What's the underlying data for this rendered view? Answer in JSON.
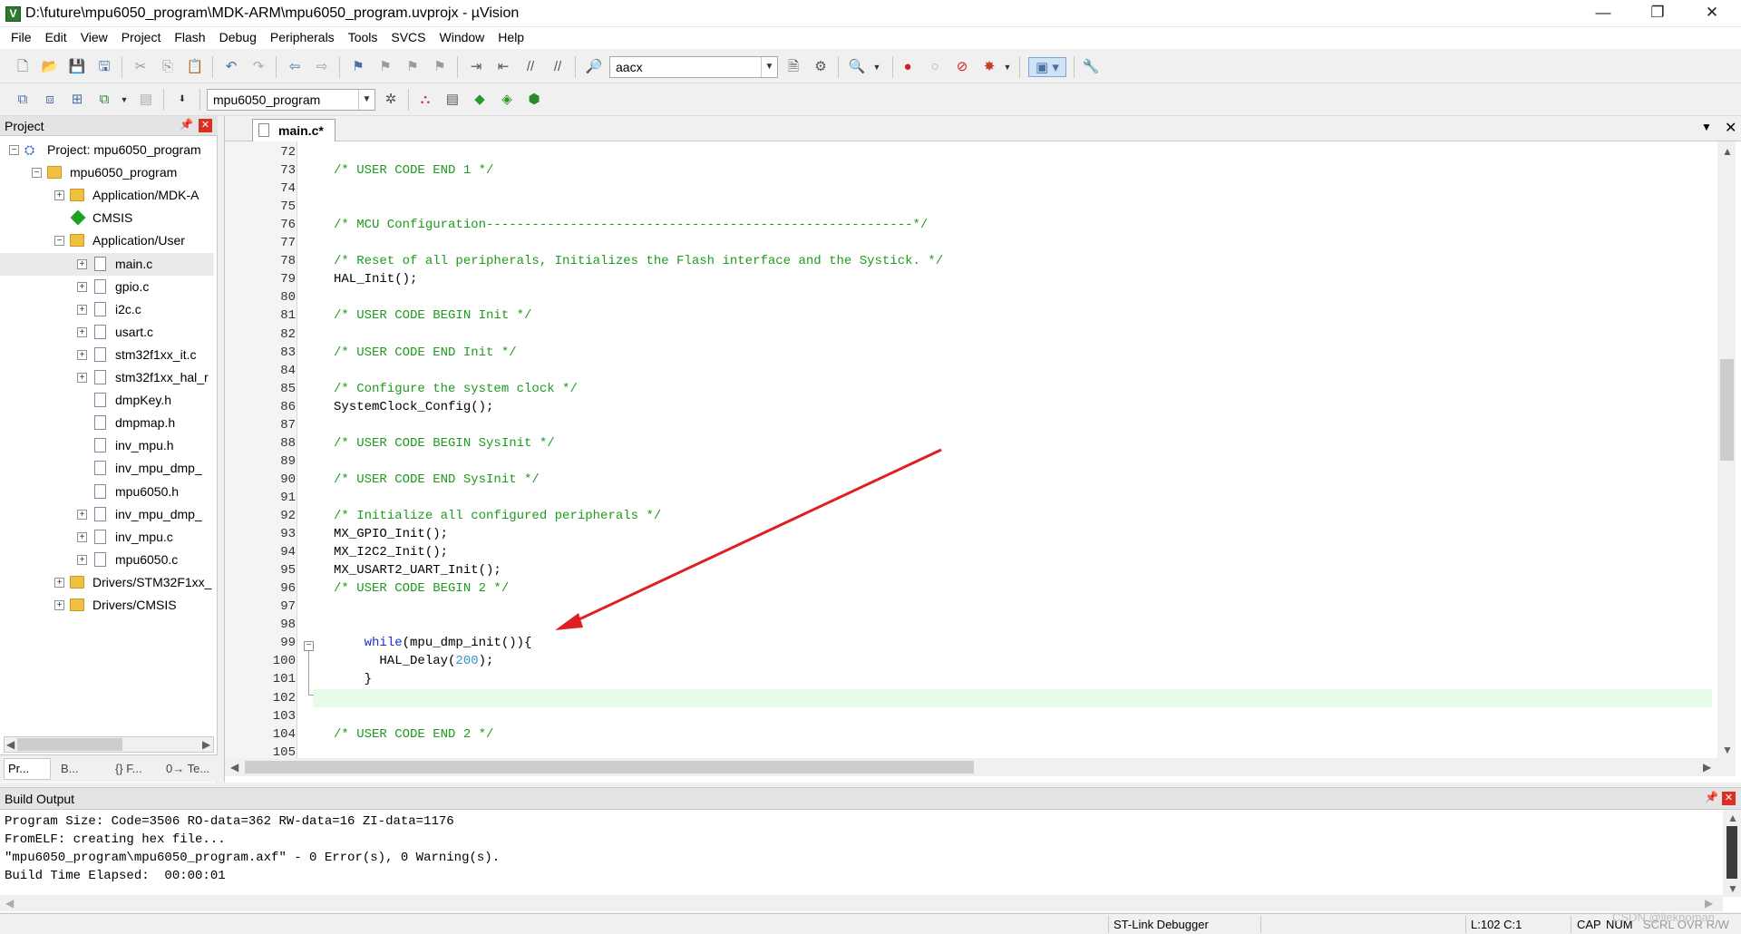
{
  "window": {
    "title": "D:\\future\\mpu6050_program\\MDK-ARM\\mpu6050_program.uvprojx - µVision",
    "app_icon_letter": "V",
    "buttons": {
      "minimize": "—",
      "restore": "❐",
      "close": "✕"
    }
  },
  "menu": [
    "File",
    "Edit",
    "View",
    "Project",
    "Flash",
    "Debug",
    "Peripherals",
    "Tools",
    "SVCS",
    "Window",
    "Help"
  ],
  "toolbar1": {
    "find_combo_value": "aacx"
  },
  "toolbar2": {
    "target_combo_value": "mpu6050_program"
  },
  "project_panel": {
    "title": "Project",
    "tree": [
      {
        "label": "Project: mpu6050_program",
        "level": 0,
        "toggle": "−",
        "icon": "project"
      },
      {
        "label": "mpu6050_program",
        "level": 1,
        "toggle": "−",
        "icon": "folder"
      },
      {
        "label": "Application/MDK-A",
        "level": 2,
        "toggle": "+",
        "icon": "folder"
      },
      {
        "label": "CMSIS",
        "level": 2,
        "toggle": "",
        "icon": "diamond"
      },
      {
        "label": "Application/User",
        "level": 2,
        "toggle": "−",
        "icon": "folder"
      },
      {
        "label": "main.c",
        "level": 3,
        "toggle": "+",
        "icon": "file",
        "selected": true
      },
      {
        "label": "gpio.c",
        "level": 3,
        "toggle": "+",
        "icon": "file"
      },
      {
        "label": "i2c.c",
        "level": 3,
        "toggle": "+",
        "icon": "file"
      },
      {
        "label": "usart.c",
        "level": 3,
        "toggle": "+",
        "icon": "file"
      },
      {
        "label": "stm32f1xx_it.c",
        "level": 3,
        "toggle": "+",
        "icon": "file"
      },
      {
        "label": "stm32f1xx_hal_r",
        "level": 3,
        "toggle": "+",
        "icon": "file"
      },
      {
        "label": "dmpKey.h",
        "level": 3,
        "toggle": "",
        "icon": "file"
      },
      {
        "label": "dmpmap.h",
        "level": 3,
        "toggle": "",
        "icon": "file"
      },
      {
        "label": "inv_mpu.h",
        "level": 3,
        "toggle": "",
        "icon": "file"
      },
      {
        "label": "inv_mpu_dmp_",
        "level": 3,
        "toggle": "",
        "icon": "file"
      },
      {
        "label": "mpu6050.h",
        "level": 3,
        "toggle": "",
        "icon": "file"
      },
      {
        "label": "inv_mpu_dmp_",
        "level": 3,
        "toggle": "+",
        "icon": "file"
      },
      {
        "label": "inv_mpu.c",
        "level": 3,
        "toggle": "+",
        "icon": "file"
      },
      {
        "label": "mpu6050.c",
        "level": 3,
        "toggle": "+",
        "icon": "file"
      },
      {
        "label": "Drivers/STM32F1xx_",
        "level": 2,
        "toggle": "+",
        "icon": "folder"
      },
      {
        "label": "Drivers/CMSIS",
        "level": 2,
        "toggle": "+",
        "icon": "folder"
      }
    ],
    "tabs": [
      "Pr...",
      "B...",
      "{} F...",
      "0→ Te..."
    ]
  },
  "editor": {
    "active_tab": "main.c*",
    "current_line": 102,
    "lines": [
      {
        "n": "72",
        "segs": []
      },
      {
        "n": "73",
        "segs": [
          {
            "t": "/* USER CODE END 1 */",
            "c": "cm"
          }
        ]
      },
      {
        "n": "74",
        "segs": []
      },
      {
        "n": "75",
        "segs": []
      },
      {
        "n": "76",
        "segs": [
          {
            "t": "/* MCU Configuration--------------------------------------------------------*/",
            "c": "cm"
          }
        ]
      },
      {
        "n": "77",
        "segs": []
      },
      {
        "n": "78",
        "segs": [
          {
            "t": "/* Reset of all peripherals, Initializes the Flash interface and the Systick. */",
            "c": "cm"
          }
        ]
      },
      {
        "n": "79",
        "segs": [
          {
            "t": "HAL_Init();",
            "c": ""
          }
        ]
      },
      {
        "n": "80",
        "segs": []
      },
      {
        "n": "81",
        "segs": [
          {
            "t": "/* USER CODE BEGIN Init */",
            "c": "cm"
          }
        ]
      },
      {
        "n": "82",
        "segs": []
      },
      {
        "n": "83",
        "segs": [
          {
            "t": "/* USER CODE END Init */",
            "c": "cm"
          }
        ]
      },
      {
        "n": "84",
        "segs": []
      },
      {
        "n": "85",
        "segs": [
          {
            "t": "/* Configure the system clock */",
            "c": "cm"
          }
        ]
      },
      {
        "n": "86",
        "segs": [
          {
            "t": "SystemClock_Config();",
            "c": ""
          }
        ]
      },
      {
        "n": "87",
        "segs": []
      },
      {
        "n": "88",
        "segs": [
          {
            "t": "/* USER CODE BEGIN SysInit */",
            "c": "cm"
          }
        ]
      },
      {
        "n": "89",
        "segs": []
      },
      {
        "n": "90",
        "segs": [
          {
            "t": "/* USER CODE END SysInit */",
            "c": "cm"
          }
        ]
      },
      {
        "n": "91",
        "segs": []
      },
      {
        "n": "92",
        "segs": [
          {
            "t": "/* Initialize all configured peripherals */",
            "c": "cm"
          }
        ]
      },
      {
        "n": "93",
        "segs": [
          {
            "t": "MX_GPIO_Init();",
            "c": ""
          }
        ]
      },
      {
        "n": "94",
        "segs": [
          {
            "t": "MX_I2C2_Init();",
            "c": ""
          }
        ]
      },
      {
        "n": "95",
        "segs": [
          {
            "t": "MX_USART2_UART_Init();",
            "c": ""
          }
        ]
      },
      {
        "n": "96",
        "segs": [
          {
            "t": "/* USER CODE BEGIN 2 */",
            "c": "cm"
          }
        ]
      },
      {
        "n": "97",
        "segs": []
      },
      {
        "n": "98",
        "segs": []
      },
      {
        "n": "99",
        "segs": [
          {
            "t": "    ",
            "c": ""
          },
          {
            "t": "while",
            "c": "kw"
          },
          {
            "t": "(mpu_dmp_init()){",
            "c": ""
          }
        ]
      },
      {
        "n": "100",
        "segs": [
          {
            "t": "      HAL_Delay(",
            "c": ""
          },
          {
            "t": "200",
            "c": "num"
          },
          {
            "t": ");",
            "c": ""
          }
        ]
      },
      {
        "n": "101",
        "segs": [
          {
            "t": "    }",
            "c": ""
          }
        ]
      },
      {
        "n": "102",
        "segs": []
      },
      {
        "n": "103",
        "segs": []
      },
      {
        "n": "104",
        "segs": [
          {
            "t": "/* USER CODE END 2 */",
            "c": "cm"
          }
        ]
      },
      {
        "n": "105",
        "segs": []
      }
    ]
  },
  "build_output": {
    "title": "Build Output",
    "lines": [
      "Program Size: Code=3506 RO-data=362 RW-data=16 ZI-data=1176",
      "FromELF: creating hex file...",
      "\"mpu6050_program\\mpu6050_program.axf\" - 0 Error(s), 0 Warning(s).",
      "Build Time Elapsed:  00:00:01"
    ]
  },
  "statusbar": {
    "debugger": "ST-Link Debugger",
    "position": "L:102 C:1",
    "cap": "CAP",
    "num": "NUM",
    "rest": "SCRL OVR R/W"
  },
  "watermark": "CSDN @lleknoman",
  "colors": {
    "comment": "#1e9a1e",
    "keyword": "#1a32c8",
    "number": "#3399cc",
    "current_line": "#e8fae8",
    "arrow": "#e02020"
  }
}
